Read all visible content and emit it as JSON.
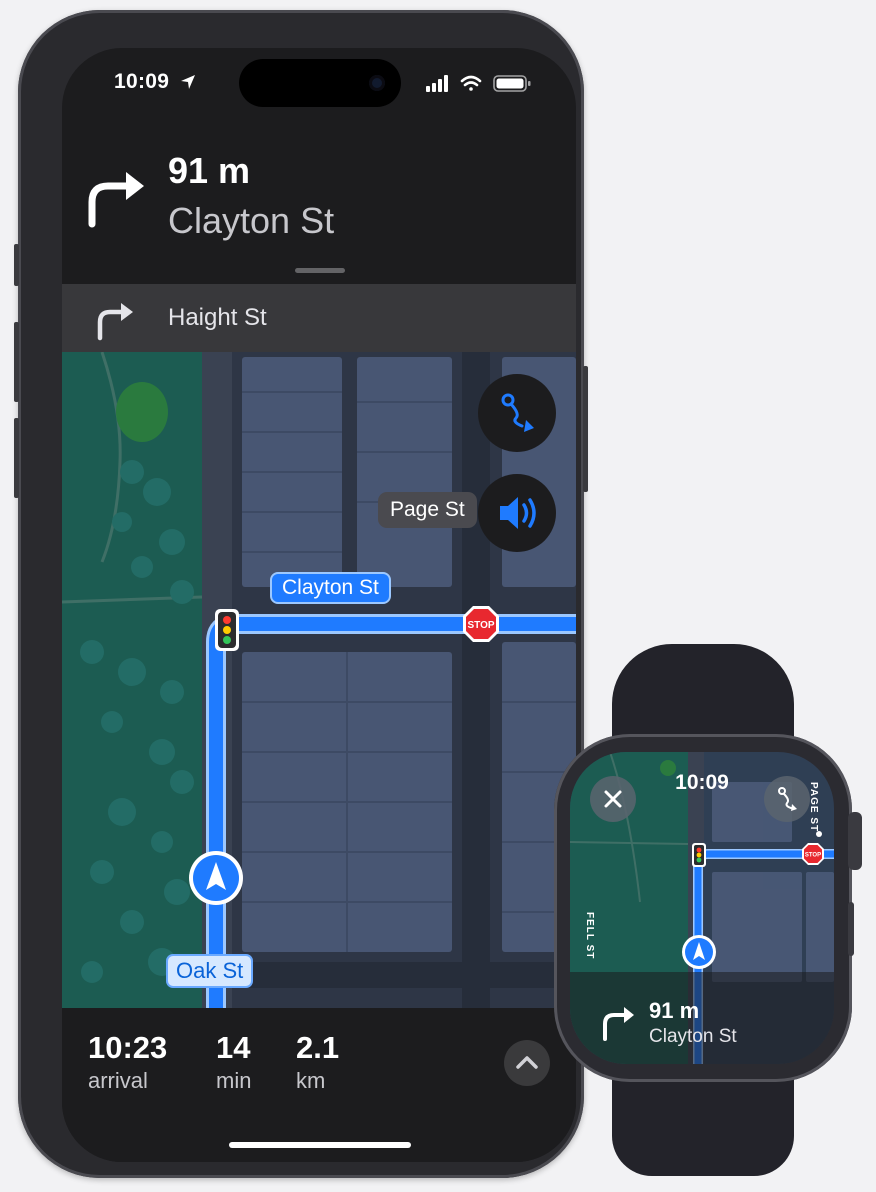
{
  "phone": {
    "status": {
      "time": "10:09"
    },
    "maneuver": {
      "distance": "91 m",
      "street": "Clayton St"
    },
    "next_maneuver": {
      "street": "Haight St"
    },
    "map": {
      "callout_page": "Page St",
      "route_label_clayton": "Clayton St",
      "label_oak": "Oak St",
      "stop_sign_text": "STOP"
    },
    "trip": {
      "arrival_value": "10:23",
      "arrival_label": "arrival",
      "duration_value": "14",
      "duration_label": "min",
      "distance_value": "2.1",
      "distance_label": "km"
    }
  },
  "watch": {
    "time": "10:09",
    "distance": "91 m",
    "street": "Clayton St",
    "side_label_fell": "FELL ST",
    "side_label_page": "PAGE ST",
    "stop_sign_text": "STOP"
  },
  "colors": {
    "route_blue": "#1f7bff",
    "park_green": "#1c5c52",
    "map_base": "#2e3646",
    "stop_red": "#e8282f"
  },
  "icons": [
    "location-arrow-icon",
    "signal-icon",
    "wifi-icon",
    "battery-icon",
    "turn-right-icon",
    "route-overview-icon",
    "speaker-icon",
    "chevron-up-icon",
    "close-icon",
    "traffic-light-icon",
    "stop-sign-icon",
    "user-location-icon"
  ]
}
